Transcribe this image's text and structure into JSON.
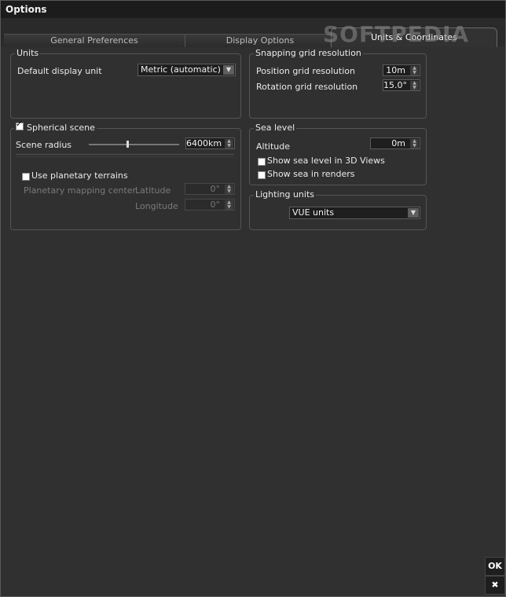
{
  "window": {
    "title": "Options"
  },
  "tabs": [
    {
      "label": "General Preferences"
    },
    {
      "label": "Display Options"
    },
    {
      "label": "Units & Coordinates"
    }
  ],
  "watermark": "SOFTPEDIA",
  "units": {
    "legend": "Units",
    "default_display_unit_label": "Default display unit",
    "default_display_unit_value": "Metric (automatic)"
  },
  "snapping": {
    "legend": "Snapping grid resolution",
    "position_label": "Position grid resolution",
    "position_value": "10m",
    "rotation_label": "Rotation grid resolution",
    "rotation_value": "15.0°"
  },
  "spherical": {
    "checkbox_label": "Spherical scene",
    "checked": true,
    "radius_label": "Scene radius",
    "radius_value": "6400km",
    "planetary_label": "Use planetary terrains",
    "planetary_checked": false,
    "mapping_center_label": "Planetary mapping center",
    "latitude_label": "Latitude",
    "latitude_value": "0°",
    "longitude_label": "Longitude",
    "longitude_value": "0°"
  },
  "sea": {
    "legend": "Sea level",
    "altitude_label": "Altitude",
    "altitude_value": "0m",
    "show_3d_label": "Show sea level in 3D Views",
    "show_3d_checked": false,
    "show_renders_label": "Show sea in renders",
    "show_renders_checked": false
  },
  "lighting": {
    "legend": "Lighting units",
    "value": "VUE units"
  },
  "buttons": {
    "ok": "OK",
    "close": "✖"
  }
}
